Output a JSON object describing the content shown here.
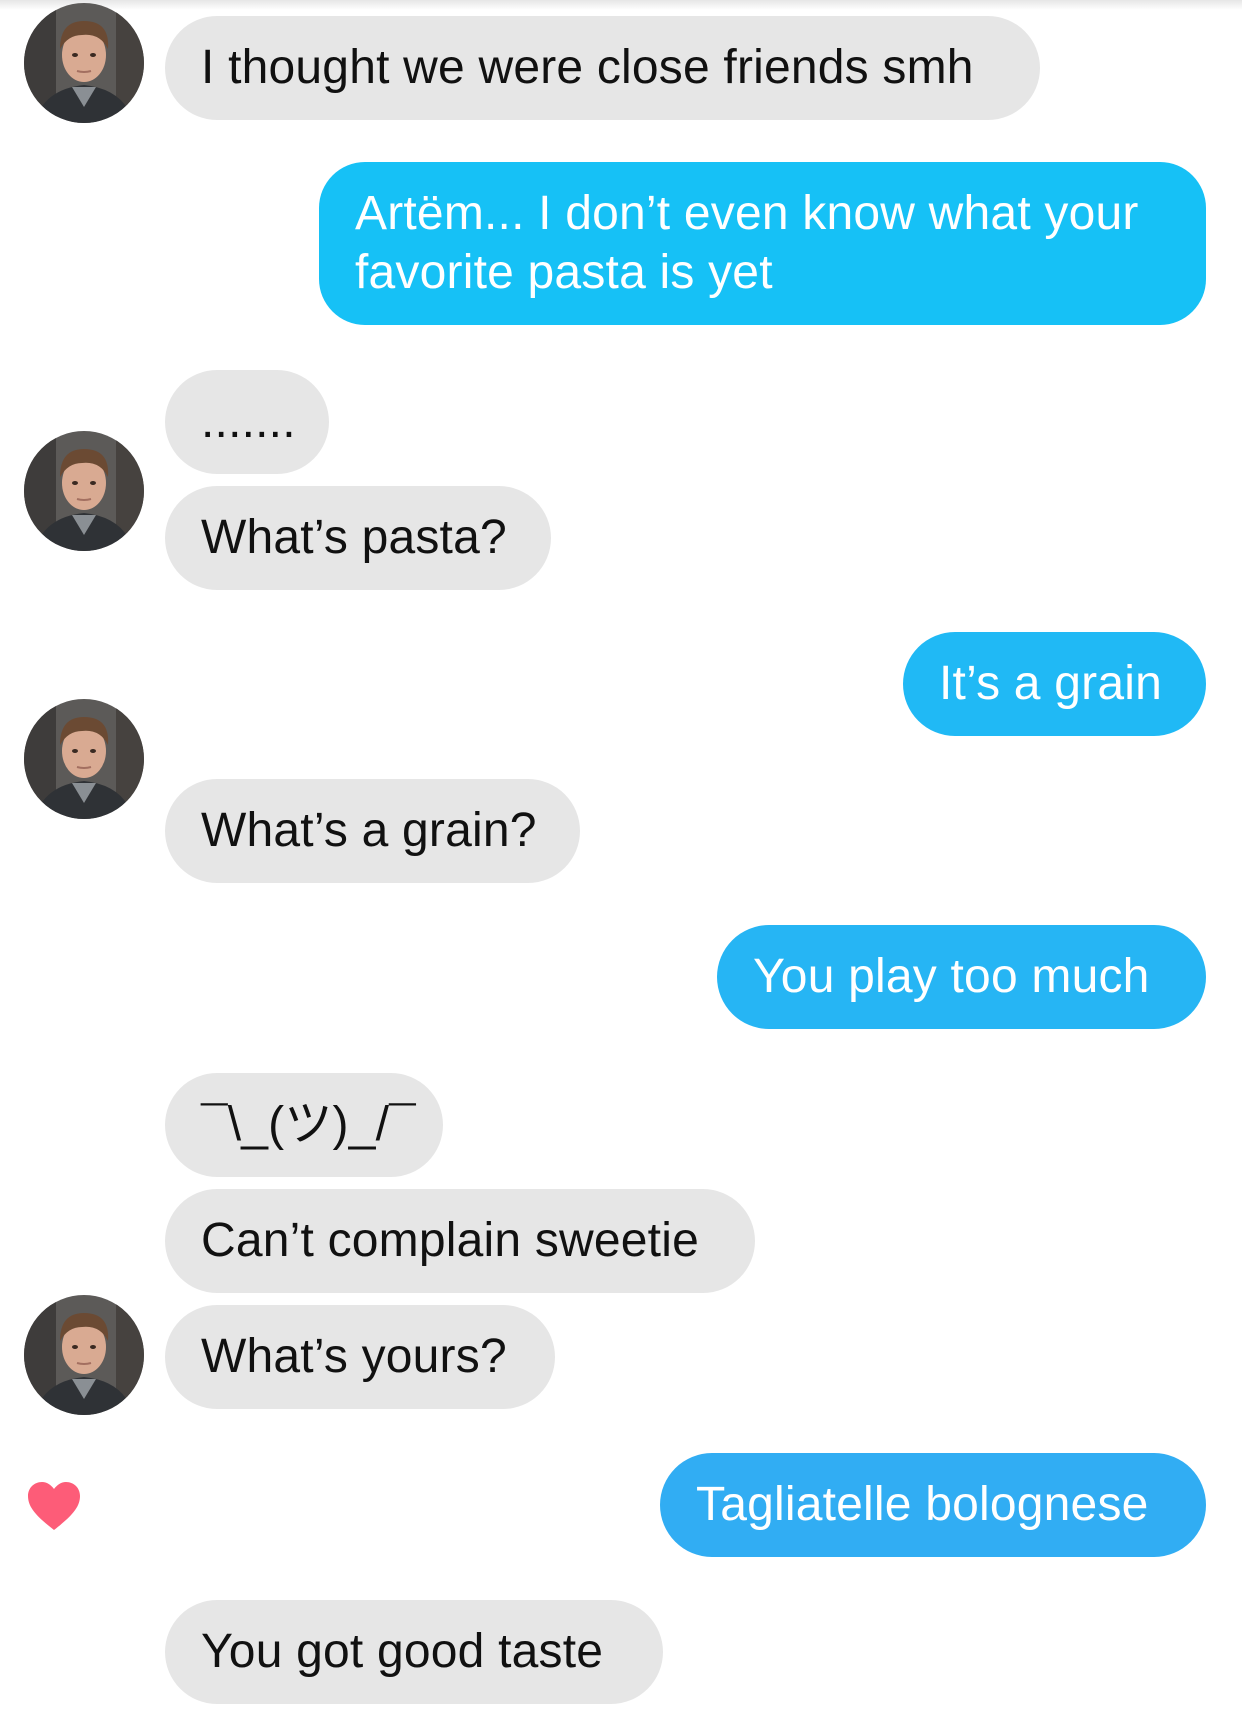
{
  "colors": {
    "incoming_bubble": "#e6e6e6",
    "outgoing_top": "#13c3f6",
    "outgoing_bottom": "#37a9f2",
    "heart": "#fd5c78"
  },
  "messages": [
    {
      "side": "incoming",
      "text": "I thought we were close friends smh"
    },
    {
      "side": "outgoing",
      "text": "Artëm... I don’t even know what your favorite pasta is yet"
    },
    {
      "side": "incoming",
      "text": "......."
    },
    {
      "side": "incoming",
      "text": "What’s pasta?"
    },
    {
      "side": "outgoing",
      "text": "It’s a grain"
    },
    {
      "side": "incoming",
      "text": "What’s a grain?"
    },
    {
      "side": "outgoing",
      "text": "You play too much"
    },
    {
      "side": "incoming",
      "text": "¯\\_(ツ)_/¯"
    },
    {
      "side": "incoming",
      "text": "Can’t complain sweetie"
    },
    {
      "side": "incoming",
      "text": "What’s yours?"
    },
    {
      "side": "outgoing",
      "text": "Tagliatelle bolognese",
      "liked": true
    },
    {
      "side": "incoming",
      "text": "You got good taste"
    }
  ],
  "icons": {
    "avatar": "contact-avatar",
    "like": "heart-icon"
  }
}
